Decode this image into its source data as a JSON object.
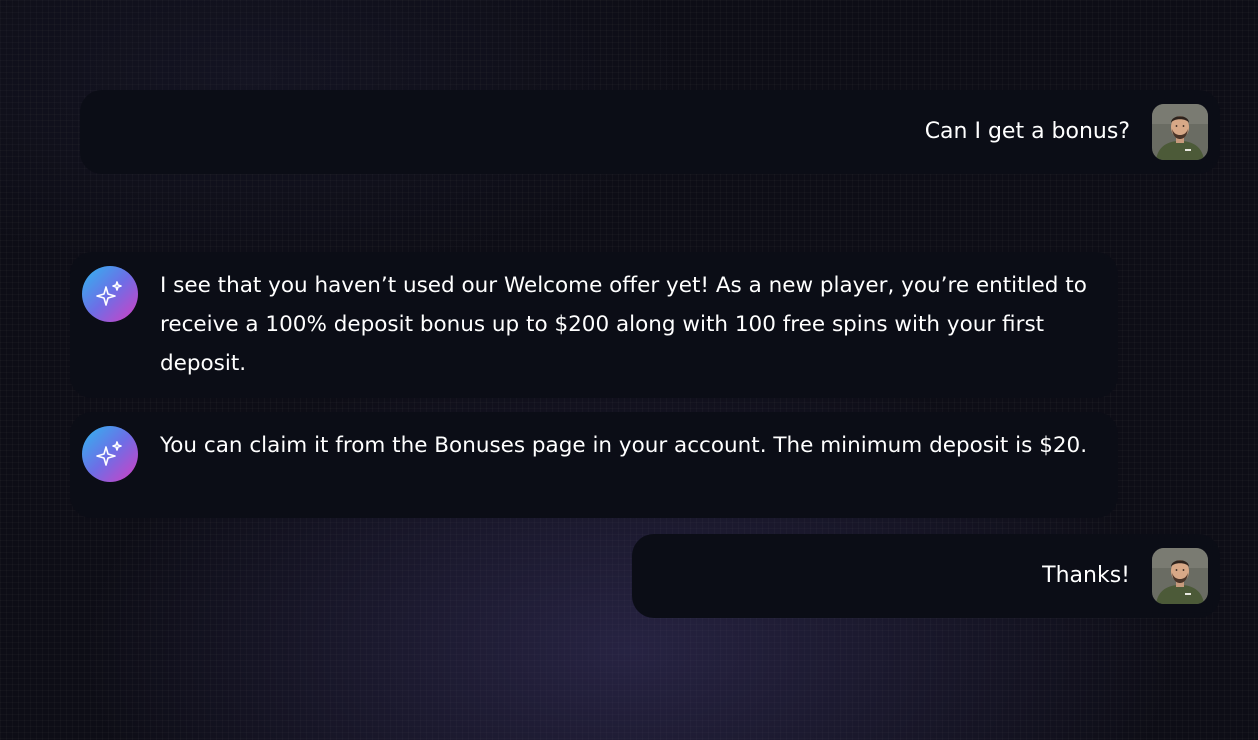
{
  "conversation": {
    "messages": [
      {
        "role": "user",
        "text": "Can I get a bonus?",
        "avatar_icon": "user-avatar"
      },
      {
        "role": "assistant",
        "text": "I see that you haven’t used our Welcome offer yet! As a new player, you’re entitled to receive a 100% deposit bonus up to $200 along with 100 free spins with your first deposit.",
        "avatar_icon": "sparkles-icon"
      },
      {
        "role": "assistant",
        "text": "You can claim it from the Bonuses page in your account. The minimum deposit is $20.",
        "avatar_icon": "sparkles-icon"
      },
      {
        "role": "user",
        "text": "Thanks!",
        "avatar_icon": "user-avatar"
      }
    ]
  },
  "colors": {
    "background": "#0d0d16",
    "bubble": "#0b0d16",
    "text": "#ffffff",
    "assistant_gradient": [
      "#2eb8f0",
      "#6d6ee6",
      "#d53ec2"
    ]
  }
}
